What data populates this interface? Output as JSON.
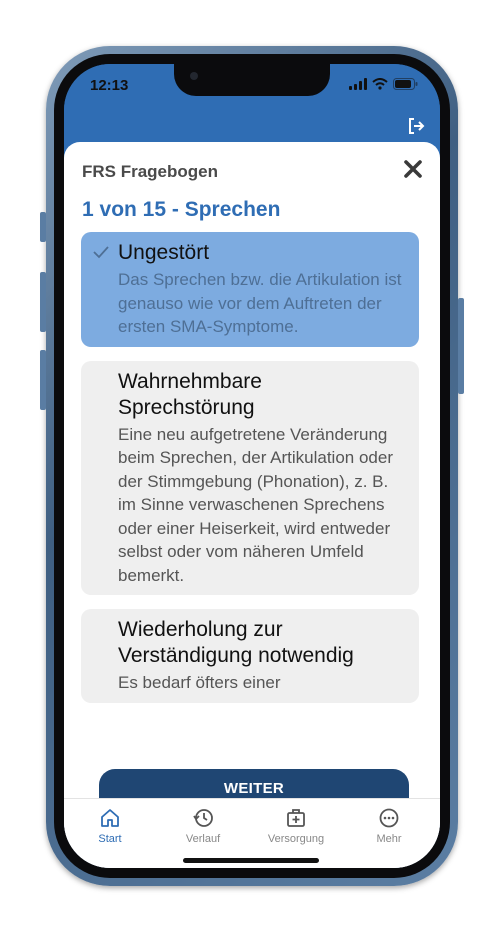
{
  "status_bar": {
    "time": "12:13"
  },
  "sheet": {
    "title": "FRS Fragebogen"
  },
  "question": {
    "title": "1 von 15 - Sprechen"
  },
  "options": [
    {
      "title": "Ungestört",
      "description": "Das Sprechen bzw. die Artikulation ist genauso wie vor dem Auftreten der ersten SMA-Symptome.",
      "selected": true
    },
    {
      "title": "Wahrnehmbare Sprechstörung",
      "description": "Eine neu aufgetretene Veränderung beim Sprechen, der Artikulation oder der Stimmgebung (Phonation), z. B. im Sinne verwaschenen Sprechens oder einer Heiserkeit, wird entweder selbst oder vom näheren Umfeld bemerkt.",
      "selected": false
    },
    {
      "title": "Wiederholung zur Verständigung notwendig",
      "description": "Es bedarf öfters einer",
      "selected": false
    }
  ],
  "actions": {
    "next_label": "WEITER"
  },
  "tabbar": {
    "items": [
      {
        "label": "Start",
        "icon": "home-icon",
        "active": true
      },
      {
        "label": "Verlauf",
        "icon": "history-icon",
        "active": false
      },
      {
        "label": "Versorgung",
        "icon": "medical-kit-icon",
        "active": false
      },
      {
        "label": "Mehr",
        "icon": "more-icon",
        "active": false
      }
    ]
  },
  "colors": {
    "primary": "#2f6db4",
    "selected_option": "#7dabe0",
    "option_bg": "#efefef",
    "button": "#1f4673"
  }
}
